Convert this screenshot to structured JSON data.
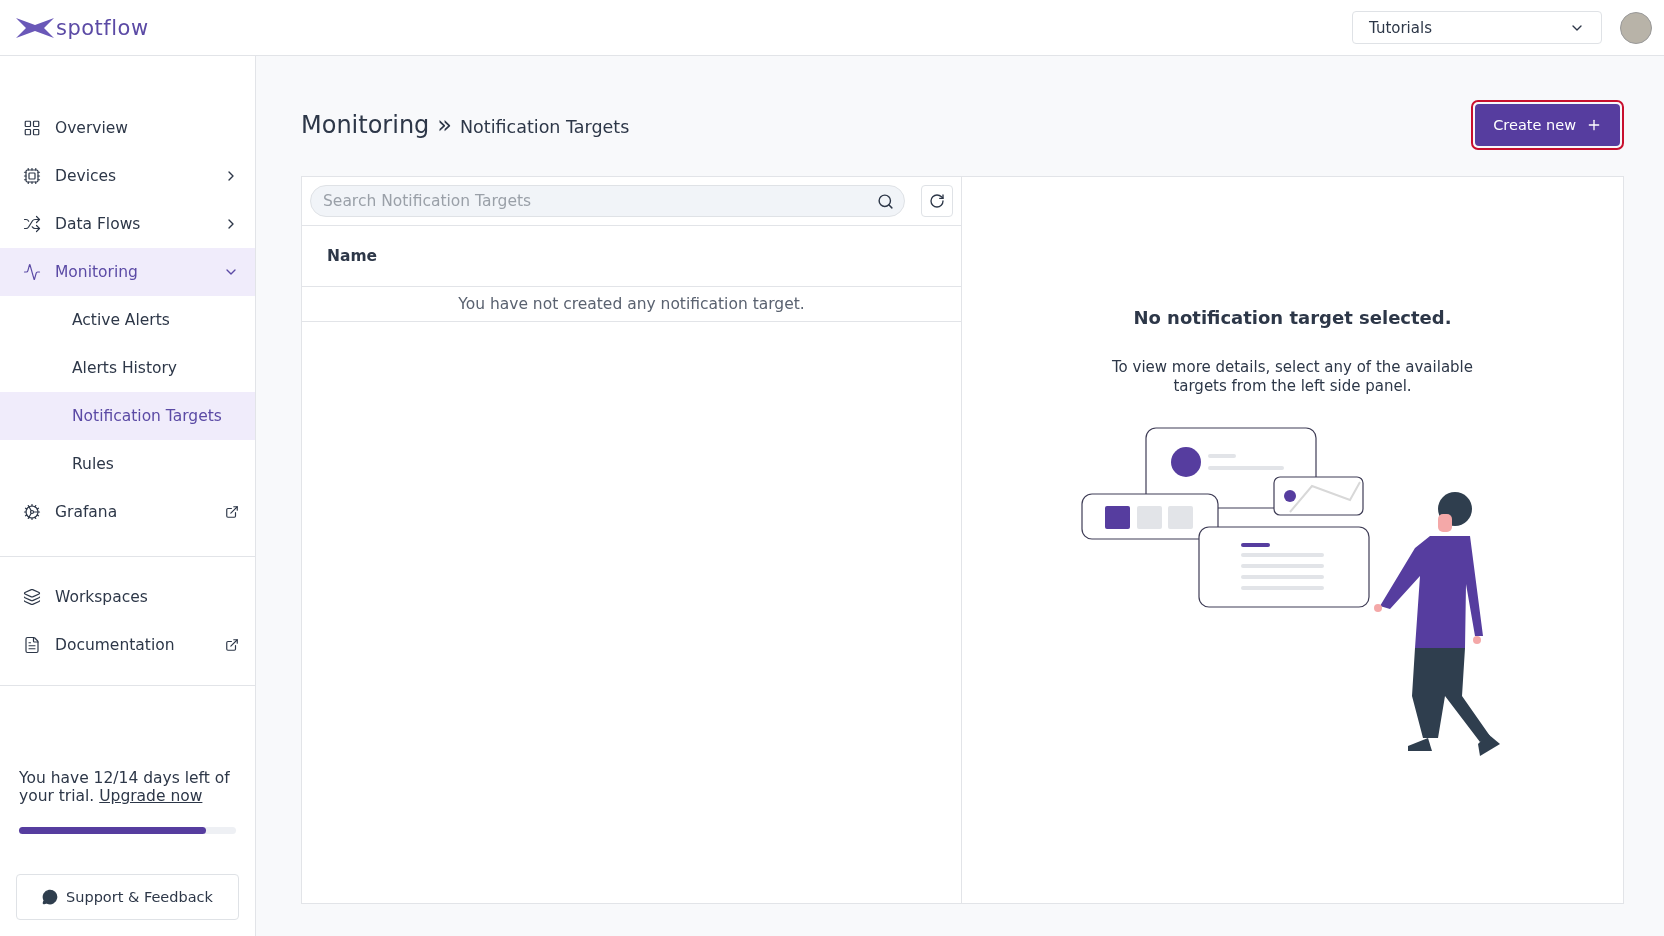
{
  "header": {
    "logo": "spotflow",
    "workspace_select": {
      "value": "Tutorials"
    }
  },
  "sidebar": {
    "groups": [
      {
        "items": [
          {
            "label": "Overview",
            "kind": "link",
            "selected": false
          },
          {
            "label": "Devices",
            "kind": "menu",
            "selected": false,
            "expanded": false
          },
          {
            "label": "Data Flows",
            "kind": "menu",
            "selected": false,
            "expanded": false
          },
          {
            "label": "Monitoring",
            "kind": "menu",
            "selected": true,
            "expanded": true,
            "children": [
              {
                "label": "Active Alerts",
                "selected": false
              },
              {
                "label": "Alerts History",
                "selected": false
              },
              {
                "label": "Notification Targets",
                "selected": true
              },
              {
                "label": "Rules",
                "selected": false
              }
            ]
          },
          {
            "label": "Grafana",
            "kind": "external",
            "selected": false
          }
        ]
      },
      {
        "items": [
          {
            "label": "Workspaces",
            "kind": "link",
            "selected": false
          },
          {
            "label": "Documentation",
            "kind": "external",
            "selected": false
          }
        ]
      }
    ],
    "trial": {
      "text": "You have 12/14 days left of your trial.",
      "link": "Upgrade now",
      "level": 0.86
    },
    "support_button": "Support & Feedback"
  },
  "page": {
    "breadcrumb": {
      "section": "Monitoring",
      "separator": "»",
      "current": "Notification Targets"
    },
    "create_button": {
      "label": "Create new",
      "focused": true
    },
    "list": {
      "search": {
        "placeholder": "Search Notification Targets"
      },
      "columns": [
        "Name"
      ],
      "empty_message": "You have not created any notification target."
    },
    "detail": {
      "title": "No notification target selected.",
      "text": "To view more details, select any of the available targets from the left side panel."
    }
  }
}
